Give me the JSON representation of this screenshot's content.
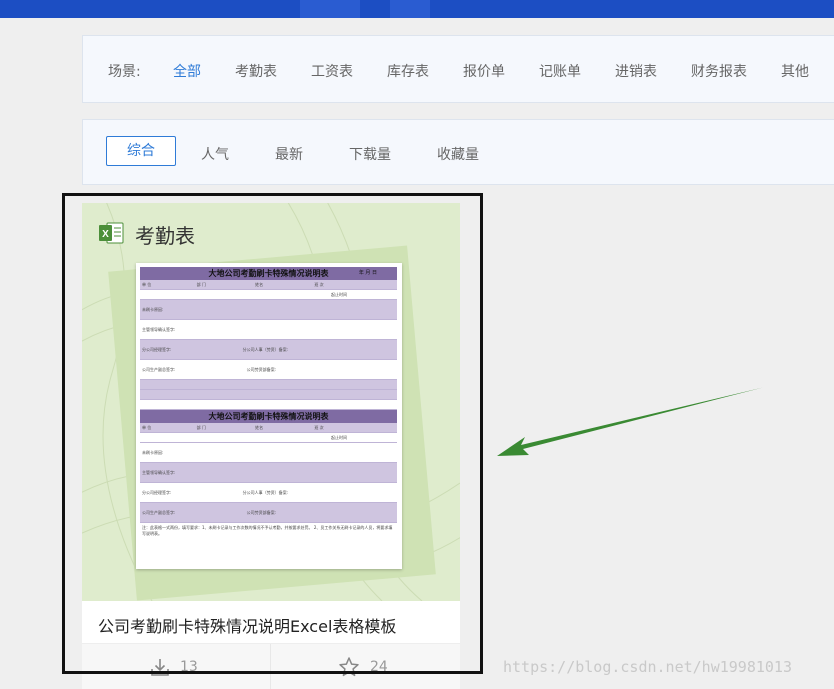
{
  "scene_filter": {
    "label": "场景:",
    "items": [
      {
        "label": "全部",
        "active": true
      },
      {
        "label": "考勤表"
      },
      {
        "label": "工资表"
      },
      {
        "label": "库存表"
      },
      {
        "label": "报价单"
      },
      {
        "label": "记账单"
      },
      {
        "label": "进销表"
      },
      {
        "label": "财务报表"
      },
      {
        "label": "其他"
      }
    ]
  },
  "sort_filter": {
    "items": [
      {
        "label": "综合",
        "active": true
      },
      {
        "label": "人气"
      },
      {
        "label": "最新"
      },
      {
        "label": "下载量"
      },
      {
        "label": "收藏量"
      }
    ]
  },
  "card": {
    "category": "考勤表",
    "file_type_icon": "excel-icon",
    "preview": {
      "form_title": "大地公司考勤刷卡特殊情况说明表",
      "date_label": "年 月 日",
      "unit": "单 位",
      "dept": "部 门",
      "name": "姓名",
      "shift": "班 次",
      "period": "起止时间",
      "reason": "未刷卡原因:",
      "supervisor": "主管领导确认签字:",
      "branch_manager": "分公司经理签字:",
      "branch_hr": "分公司人事（劳资）备案:",
      "production": "公司生产副总签字:",
      "hr_dept": "公司劳资部备案:",
      "note": "注：此表格一式两份，填写要求：1、未刷卡记录与工作次数的情况不予认考勤，并按要求处罚。 2、员工作关系无刷卡记录的人员，将要求填写说明表。"
    },
    "title": "公司考勤刷卡特殊情况说明Excel表格模板",
    "downloads": "13",
    "favorites": "24",
    "download_icon": "download-icon",
    "favorite_icon": "star-icon"
  },
  "annotation": {
    "arrow_color": "#3a8a33",
    "box_color": "#111111"
  },
  "watermark": "https://blog.csdn.net/hw19981013"
}
